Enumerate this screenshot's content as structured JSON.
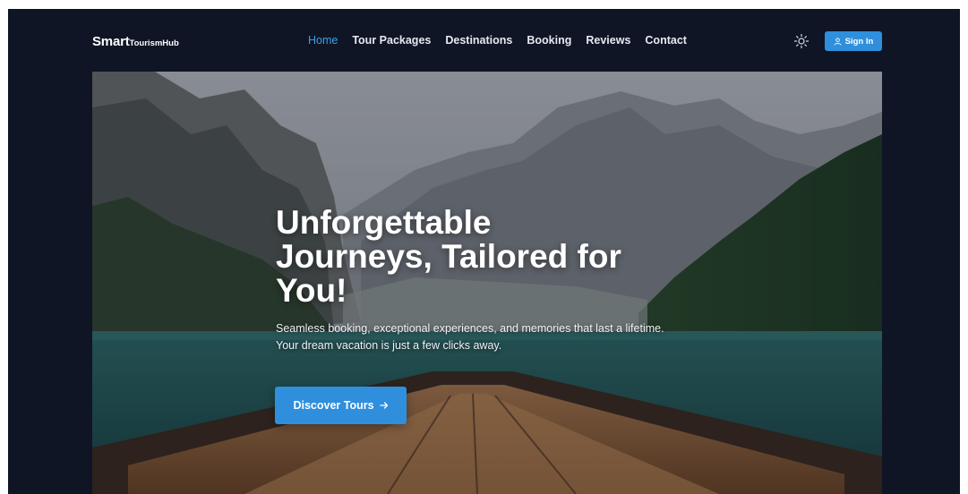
{
  "header": {
    "logo_strong": "Smart",
    "logo_small": "TourismHub",
    "nav": [
      "Home",
      "Tour Packages",
      "Destinations",
      "Booking",
      "Reviews",
      "Contact"
    ],
    "active_nav": "Home",
    "theme_icon": "sun-icon",
    "signin_icon": "user-icon",
    "signin_label": "Sign In"
  },
  "hero": {
    "title_lines": [
      "Unforgettable",
      "Journeys, Tailored for",
      "You!"
    ],
    "subtitle": "Seamless booking, exceptional experiences, and memories that last a lifetime. Your dream vacation is just a few clicks away.",
    "cta_label": "Discover Tours",
    "cta_icon": "arrow-right-icon"
  },
  "colors": {
    "page_background": "#0f1525",
    "accent": "#2f8fdd",
    "active_nav": "#3aa1e8"
  }
}
